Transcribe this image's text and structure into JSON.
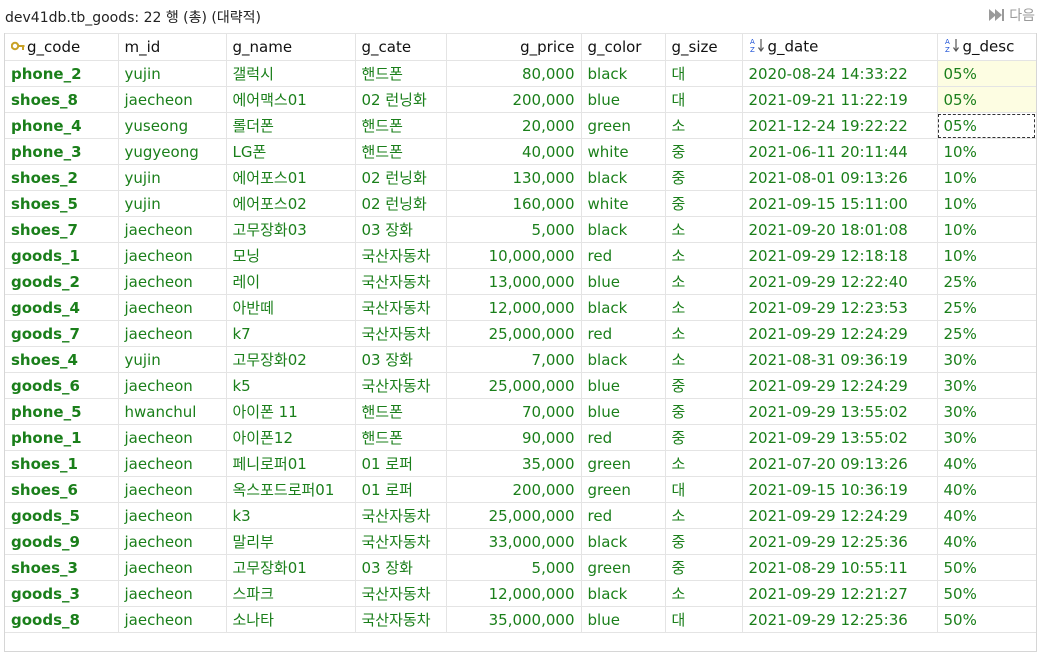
{
  "title": "dev41db.tb_goods: 22 행 (총) (대략적)",
  "next_label": "다음",
  "columns": {
    "g_code": "g_code",
    "m_id": "m_id",
    "g_name": "g_name",
    "g_cate": "g_cate",
    "g_price": "g_price",
    "g_color": "g_color",
    "g_size": "g_size",
    "g_date": "g_date",
    "g_desc": "g_desc"
  },
  "rows": [
    {
      "g_code": "phone_2",
      "m_id": "yujin",
      "g_name": "갤럭시",
      "g_cate": "핸드폰",
      "g_price": "80,000",
      "g_color": "black",
      "g_size": "대",
      "g_date": "2020-08-24 14:33:22",
      "g_desc": "05%"
    },
    {
      "g_code": "shoes_8",
      "m_id": "jaecheon",
      "g_name": "에어맥스01",
      "g_cate": "02 런닝화",
      "g_price": "200,000",
      "g_color": "blue",
      "g_size": "대",
      "g_date": "2021-09-21 11:22:19",
      "g_desc": "05%"
    },
    {
      "g_code": "phone_4",
      "m_id": "yuseong",
      "g_name": "롤더폰",
      "g_cate": "핸드폰",
      "g_price": "20,000",
      "g_color": "green",
      "g_size": "소",
      "g_date": "2021-12-24 19:22:22",
      "g_desc": "05%"
    },
    {
      "g_code": "phone_3",
      "m_id": "yugyeong",
      "g_name": "LG폰",
      "g_cate": "핸드폰",
      "g_price": "40,000",
      "g_color": "white",
      "g_size": "중",
      "g_date": "2021-06-11 20:11:44",
      "g_desc": "10%"
    },
    {
      "g_code": "shoes_2",
      "m_id": "yujin",
      "g_name": "에어포스01",
      "g_cate": "02 런닝화",
      "g_price": "130,000",
      "g_color": "black",
      "g_size": "중",
      "g_date": "2021-08-01 09:13:26",
      "g_desc": "10%"
    },
    {
      "g_code": "shoes_5",
      "m_id": "yujin",
      "g_name": "에어포스02",
      "g_cate": "02 런닝화",
      "g_price": "160,000",
      "g_color": "white",
      "g_size": "중",
      "g_date": "2021-09-15 15:11:00",
      "g_desc": "10%"
    },
    {
      "g_code": "shoes_7",
      "m_id": "jaecheon",
      "g_name": "고무장화03",
      "g_cate": "03 장화",
      "g_price": "5,000",
      "g_color": "black",
      "g_size": "소",
      "g_date": "2021-09-20 18:01:08",
      "g_desc": "10%"
    },
    {
      "g_code": "goods_1",
      "m_id": "jaecheon",
      "g_name": "모닝",
      "g_cate": "국산자동차",
      "g_price": "10,000,000",
      "g_color": "red",
      "g_size": "소",
      "g_date": "2021-09-29 12:18:18",
      "g_desc": "10%"
    },
    {
      "g_code": "goods_2",
      "m_id": "jaecheon",
      "g_name": "레이",
      "g_cate": "국산자동차",
      "g_price": "13,000,000",
      "g_color": "blue",
      "g_size": "소",
      "g_date": "2021-09-29 12:22:40",
      "g_desc": "25%"
    },
    {
      "g_code": "goods_4",
      "m_id": "jaecheon",
      "g_name": "아반떼",
      "g_cate": "국산자동차",
      "g_price": "12,000,000",
      "g_color": "black",
      "g_size": "소",
      "g_date": "2021-09-29 12:23:53",
      "g_desc": "25%"
    },
    {
      "g_code": "goods_7",
      "m_id": "jaecheon",
      "g_name": "k7",
      "g_cate": "국산자동차",
      "g_price": "25,000,000",
      "g_color": "red",
      "g_size": "소",
      "g_date": "2021-09-29 12:24:29",
      "g_desc": "25%"
    },
    {
      "g_code": "shoes_4",
      "m_id": "yujin",
      "g_name": "고무장화02",
      "g_cate": "03 장화",
      "g_price": "7,000",
      "g_color": "black",
      "g_size": "소",
      "g_date": "2021-08-31 09:36:19",
      "g_desc": "30%"
    },
    {
      "g_code": "goods_6",
      "m_id": "jaecheon",
      "g_name": "k5",
      "g_cate": "국산자동차",
      "g_price": "25,000,000",
      "g_color": "blue",
      "g_size": "중",
      "g_date": "2021-09-29 12:24:29",
      "g_desc": "30%"
    },
    {
      "g_code": "phone_5",
      "m_id": "hwanchul",
      "g_name": "아이폰 11",
      "g_cate": "핸드폰",
      "g_price": "70,000",
      "g_color": "blue",
      "g_size": "중",
      "g_date": "2021-09-29 13:55:02",
      "g_desc": "30%"
    },
    {
      "g_code": "phone_1",
      "m_id": "jaecheon",
      "g_name": "아이폰12",
      "g_cate": "핸드폰",
      "g_price": "90,000",
      "g_color": "red",
      "g_size": "중",
      "g_date": "2021-09-29 13:55:02",
      "g_desc": "30%"
    },
    {
      "g_code": "shoes_1",
      "m_id": "jaecheon",
      "g_name": "페니로퍼01",
      "g_cate": "01 로퍼",
      "g_price": "35,000",
      "g_color": "green",
      "g_size": "소",
      "g_date": "2021-07-20 09:13:26",
      "g_desc": "40%"
    },
    {
      "g_code": "shoes_6",
      "m_id": "jaecheon",
      "g_name": "옥스포드로퍼01",
      "g_cate": "01 로퍼",
      "g_price": "200,000",
      "g_color": "green",
      "g_size": "대",
      "g_date": "2021-09-15 10:36:19",
      "g_desc": "40%"
    },
    {
      "g_code": "goods_5",
      "m_id": "jaecheon",
      "g_name": "k3",
      "g_cate": "국산자동차",
      "g_price": "25,000,000",
      "g_color": "red",
      "g_size": "소",
      "g_date": "2021-09-29 12:24:29",
      "g_desc": "40%"
    },
    {
      "g_code": "goods_9",
      "m_id": "jaecheon",
      "g_name": "말리부",
      "g_cate": "국산자동차",
      "g_price": "33,000,000",
      "g_color": "black",
      "g_size": "중",
      "g_date": "2021-09-29 12:25:36",
      "g_desc": "40%"
    },
    {
      "g_code": "shoes_3",
      "m_id": "jaecheon",
      "g_name": "고무장화01",
      "g_cate": "03 장화",
      "g_price": "5,000",
      "g_color": "green",
      "g_size": "중",
      "g_date": "2021-08-29 10:55:11",
      "g_desc": "50%"
    },
    {
      "g_code": "goods_3",
      "m_id": "jaecheon",
      "g_name": "스파크",
      "g_cate": "국산자동차",
      "g_price": "12,000,000",
      "g_color": "black",
      "g_size": "소",
      "g_date": "2021-09-29 12:21:27",
      "g_desc": "50%"
    },
    {
      "g_code": "goods_8",
      "m_id": "jaecheon",
      "g_name": "소나타",
      "g_cate": "국산자동차",
      "g_price": "35,000,000",
      "g_color": "blue",
      "g_size": "대",
      "g_date": "2021-09-29 12:25:36",
      "g_desc": "50%"
    }
  ],
  "highlighted_desc_rows": [
    0,
    1
  ],
  "focused_cell": {
    "row": 2,
    "column": "g_desc"
  },
  "icons": {
    "primary_key": "key-icon",
    "sort": "sort-az-icon",
    "next": "skip-forward-icon"
  },
  "colors": {
    "key_text": "#1a8a1a",
    "text": "#1a7f1a",
    "number": "#1414d6",
    "highlight": "#fdfde2"
  }
}
